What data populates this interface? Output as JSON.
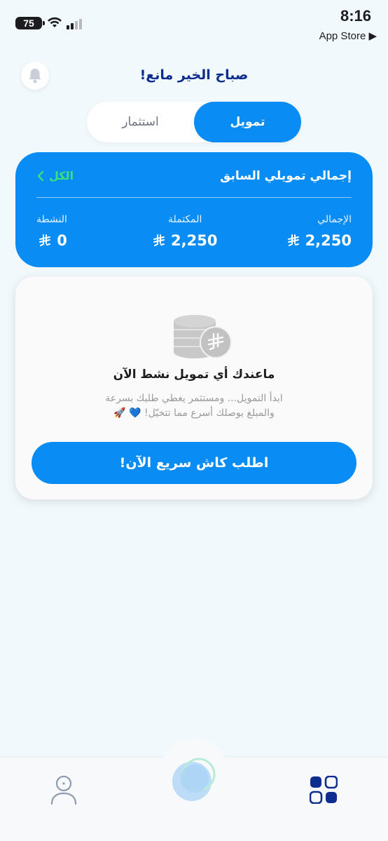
{
  "status_bar": {
    "battery": "75",
    "time": "8:16",
    "back_label": "App Store ▶"
  },
  "header": {
    "greeting": "صباح الخير مانع!",
    "bell_icon": "bell-icon"
  },
  "tabs": [
    {
      "label": "تمويل",
      "active": true
    },
    {
      "label": "استثمار",
      "active": false
    }
  ],
  "summary": {
    "title": "إجمالي تمويلي السابق",
    "all_link": "الكل",
    "stats": {
      "total_label": "الإجمالي",
      "total_value": "2,250",
      "completed_label": "المكتملة",
      "completed_value": "2,250",
      "active_label": "النشطة",
      "active_value": "0"
    },
    "currency_icon": "riyal-icon"
  },
  "empty_state": {
    "title": "ماعندك أي تمويل نشط الآن",
    "line1": "ابدأ التمويل... ومستثمر يغطي طلبك بسرعة",
    "line2": "والمبلغ يوصلك أسرع مما تتخيّل! 💙 🚀",
    "cta": "اطلب كاش سريع الآن!"
  },
  "colors": {
    "accent": "#0a8cf5",
    "greeting": "#0d2d8f",
    "link_green": "#3ee07a",
    "background": "#f2f9fd"
  },
  "bottom_nav": [
    "profile-icon",
    "home-orb-icon",
    "apps-grid-icon"
  ]
}
